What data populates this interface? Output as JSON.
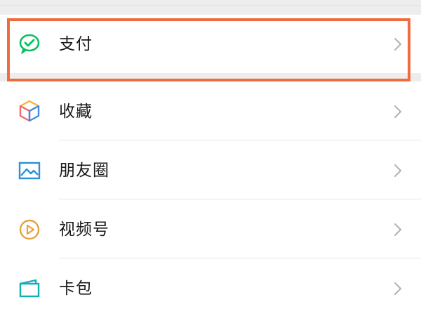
{
  "menu": {
    "items": [
      {
        "label": "支付",
        "icon": "wechat-pay-icon",
        "icon_color": "#07c160"
      },
      {
        "label": "收藏",
        "icon": "favorites-cube-icon",
        "icon_color": "#f2b33d"
      },
      {
        "label": "朋友圈",
        "icon": "moments-image-icon",
        "icon_color": "#2d8fd5"
      },
      {
        "label": "视频号",
        "icon": "channels-play-icon",
        "icon_color": "#e6a23c"
      },
      {
        "label": "卡包",
        "icon": "card-wallet-icon",
        "icon_color": "#10aeb5"
      }
    ],
    "highlighted_item": "支付",
    "highlight_color": "#ef6c40"
  }
}
